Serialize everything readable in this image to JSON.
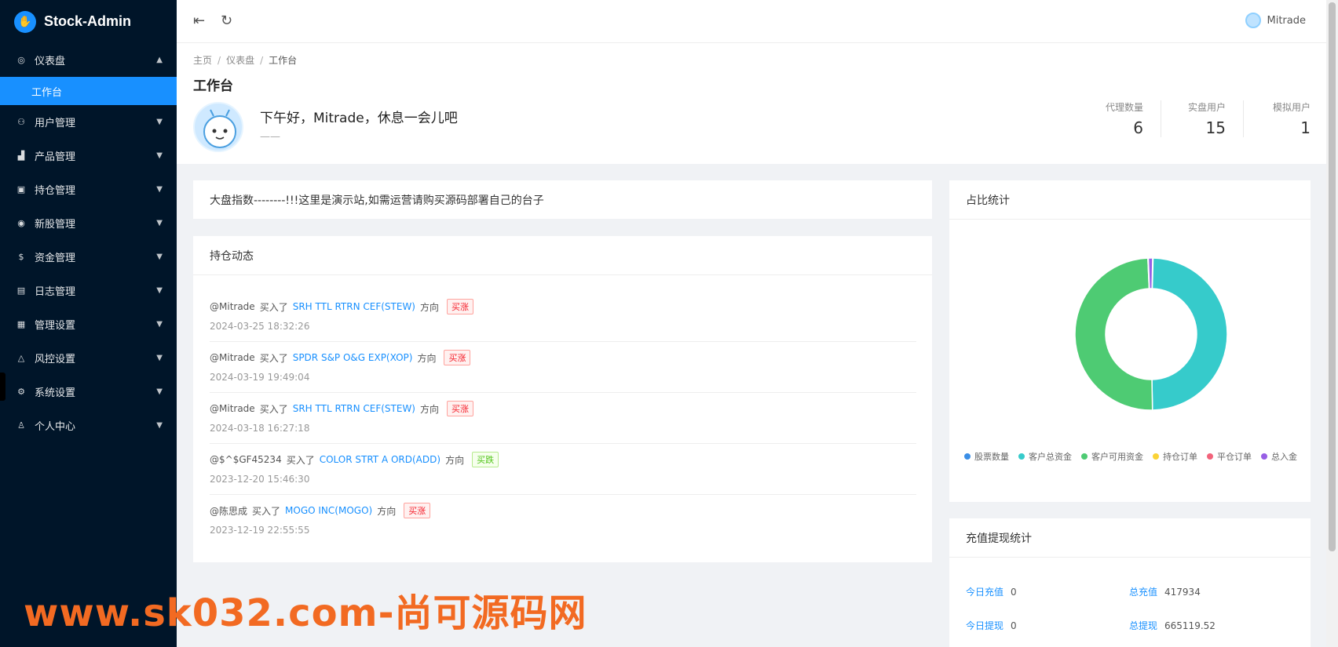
{
  "app": {
    "name": "Stock-Admin"
  },
  "sidebar": {
    "items": [
      {
        "icon": "dashboard-icon",
        "glyph": "◎",
        "label": "仪表盘",
        "open": true
      },
      {
        "icon": "user-icon",
        "glyph": "⚇",
        "label": "用户管理"
      },
      {
        "icon": "chart-icon",
        "glyph": "▟",
        "label": "产品管理"
      },
      {
        "icon": "position-icon",
        "glyph": "▣",
        "label": "持仓管理"
      },
      {
        "icon": "broadcast-icon",
        "glyph": "◉",
        "label": "新股管理"
      },
      {
        "icon": "money-icon",
        "glyph": "$",
        "label": "资金管理"
      },
      {
        "icon": "log-icon",
        "glyph": "▤",
        "label": "日志管理"
      },
      {
        "icon": "settings-panel-icon",
        "glyph": "▦",
        "label": "管理设置"
      },
      {
        "icon": "warning-icon",
        "glyph": "△",
        "label": "风控设置"
      },
      {
        "icon": "gear-icon",
        "glyph": "⚙",
        "label": "系统设置"
      },
      {
        "icon": "person-icon",
        "glyph": "♙",
        "label": "个人中心"
      }
    ],
    "active_sub": "工作台"
  },
  "header": {
    "username": "Mitrade"
  },
  "breadcrumb": [
    "主页",
    "仪表盘",
    "工作台"
  ],
  "page": {
    "title": "工作台",
    "welcome": "下午好，Mitrade，休息一会儿吧",
    "welcome_sub": "——"
  },
  "stats": [
    {
      "label": "代理数量",
      "value": "6"
    },
    {
      "label": "实盘用户",
      "value": "15"
    },
    {
      "label": "模拟用户",
      "value": "1"
    }
  ],
  "notice": "大盘指数--------!!!这里是演示站,如需运营请购买源码部署自己的台子",
  "feed": {
    "title": "持仓动态",
    "bought_text": "买入了",
    "direction_text": "方向",
    "items": [
      {
        "user": "@Mitrade",
        "stock": "SRH TTL RTRN CEF(STEW)",
        "tag": "买涨",
        "up": true,
        "time": "2024-03-25 18:32:26"
      },
      {
        "user": "@Mitrade",
        "stock": "SPDR S&P O&G EXP(XOP)",
        "tag": "买涨",
        "up": true,
        "time": "2024-03-19 19:49:04"
      },
      {
        "user": "@Mitrade",
        "stock": "SRH TTL RTRN CEF(STEW)",
        "tag": "买涨",
        "up": true,
        "time": "2024-03-18 16:27:18"
      },
      {
        "user": "@$^$GF45234",
        "stock": "COLOR STRT A ORD(ADD)",
        "tag": "买跌",
        "up": false,
        "time": "2023-12-20 15:46:30"
      },
      {
        "user": "@陈思成",
        "stock": "MOGO INC(MOGO)",
        "tag": "买涨",
        "up": true,
        "time": "2023-12-19 22:55:55"
      }
    ]
  },
  "ratio": {
    "title": "占比统计",
    "legend": [
      {
        "label": "股票数量",
        "color": "#3a8ee6"
      },
      {
        "label": "客户总资金",
        "color": "#36cbcb"
      },
      {
        "label": "客户可用资金",
        "color": "#4ecb73"
      },
      {
        "label": "持仓订单",
        "color": "#fad337"
      },
      {
        "label": "平仓订单",
        "color": "#f2637b"
      },
      {
        "label": "总入金",
        "color": "#975fe5"
      }
    ]
  },
  "chart_data": {
    "type": "pie",
    "categories": [
      "股票数量",
      "客户总资金",
      "客户可用资金",
      "持仓订单",
      "平仓订单",
      "总入金"
    ],
    "values": [
      0.1,
      49.3,
      49.6,
      0.05,
      0.05,
      0.9
    ],
    "colors": [
      "#3a8ee6",
      "#36cbcb",
      "#4ecb73",
      "#fad337",
      "#f2637b",
      "#975fe5"
    ],
    "legend_position": "bottom"
  },
  "recharge": {
    "title": "充值提现统计",
    "rows": [
      [
        {
          "k": "今日充值",
          "v": "0"
        },
        {
          "k": "总充值",
          "v": "417934"
        }
      ],
      [
        {
          "k": "今日提现",
          "v": "0"
        },
        {
          "k": "总提现",
          "v": "665119.52"
        }
      ]
    ]
  },
  "watermark": "www.sk032.com-尚可源码网"
}
